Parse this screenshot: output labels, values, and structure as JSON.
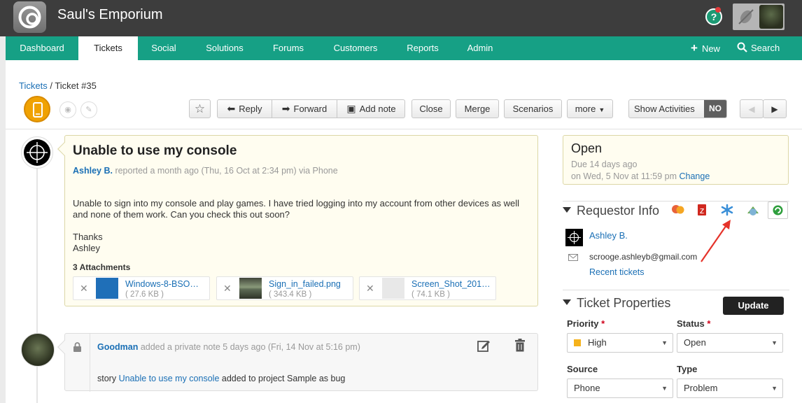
{
  "app": {
    "title": "Saul's Emporium"
  },
  "nav": {
    "tabs": [
      {
        "label": "Dashboard"
      },
      {
        "label": "Tickets"
      },
      {
        "label": "Social"
      },
      {
        "label": "Solutions"
      },
      {
        "label": "Forums"
      },
      {
        "label": "Customers"
      },
      {
        "label": "Reports"
      },
      {
        "label": "Admin"
      }
    ],
    "new_label": "New",
    "search_label": "Search",
    "accent": "#16a085"
  },
  "breadcrumb": {
    "root": "Tickets",
    "sep": " / ",
    "current": "Ticket #35"
  },
  "toolbar": {
    "reply": "Reply",
    "forward": "Forward",
    "add_note": "Add note",
    "close": "Close",
    "merge": "Merge",
    "scenarios": "Scenarios",
    "more": "more",
    "show_activities": "Show Activities",
    "show_activities_state": "NO"
  },
  "ticket": {
    "subject": "Unable to use my console",
    "requester": "Ashley B.",
    "meta": " reported a month ago (Thu, 16 Oct at 2:34 pm) via Phone",
    "body_p1": "Unable to sign into my console and play games. I have tried logging into my account from other devices as well and none of them work. Can you check this out soon?",
    "body_thanks": "Thanks",
    "body_sign": "Ashley",
    "attachments_title": "3 Attachments",
    "attachments": [
      {
        "name": "Windows-8-BSO…",
        "size": "( 27.6 KB )"
      },
      {
        "name": "Sign_in_failed.png",
        "size": "( 343.4 KB )"
      },
      {
        "name": "Screen_Shot_201…",
        "size": "( 74.1 KB )"
      }
    ]
  },
  "note": {
    "author": "Goodman",
    "meta": " added a private note 5 days ago (Fri, 14 Nov at 5:16 pm)",
    "text_prefix": "story ",
    "text_link": "Unable to use my console",
    "text_suffix": " added to project Sample as bug"
  },
  "status": {
    "state": "Open",
    "due": "Due 14 days ago",
    "due_date": "on Wed, 5 Nov at 11:59 pm ",
    "change": "Change"
  },
  "requestor": {
    "heading": "Requestor Info",
    "name": "Ashley B.",
    "email": "scrooge.ashleyb@gmail.com",
    "recent": "Recent tickets"
  },
  "properties": {
    "heading": "Ticket Properties",
    "update": "Update",
    "priority_label": "Priority",
    "priority_value": "High",
    "status_label": "Status",
    "status_value": "Open",
    "source_label": "Source",
    "source_value": "Phone",
    "type_label": "Type",
    "type_value": "Problem",
    "required_mark": "*"
  }
}
